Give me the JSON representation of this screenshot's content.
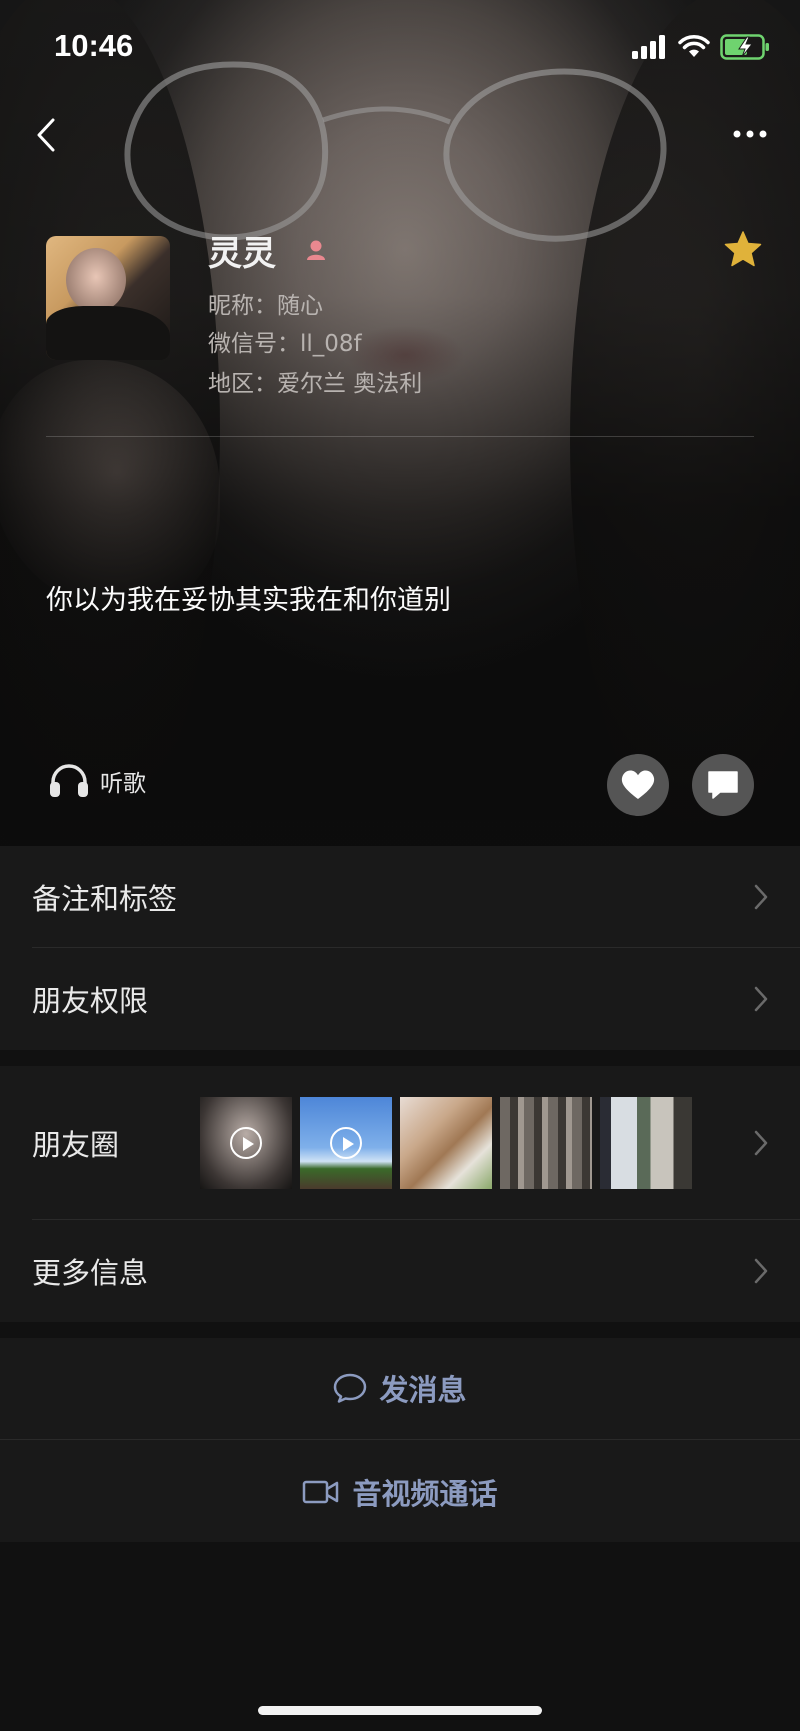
{
  "status_bar": {
    "time": "10:46"
  },
  "profile": {
    "name": "灵灵",
    "nickname": "昵称：随心",
    "wechat_id": "微信号：ll_08f",
    "region": "地区：爱尔兰 奥法利",
    "signature": "你以为我在妥协其实我在和你道别",
    "listen_label": "听歌"
  },
  "list": {
    "remarks_tags": "备注和标签",
    "friend_permissions": "朋友权限",
    "moments": "朋友圈",
    "more_info": "更多信息"
  },
  "actions": {
    "send_message": "发消息",
    "video_call": "音视频通话"
  },
  "colors": {
    "star": "#e0b23a",
    "female": "#e9888f",
    "action_text": "#8c9bc0",
    "battery": "#6fd36f"
  },
  "icons": [
    "back-icon",
    "more-icon",
    "female-icon",
    "star-icon",
    "headphones-icon",
    "heart-icon",
    "comment-icon",
    "chevron-right-icon",
    "chat-bubble-icon",
    "video-camera-icon"
  ]
}
